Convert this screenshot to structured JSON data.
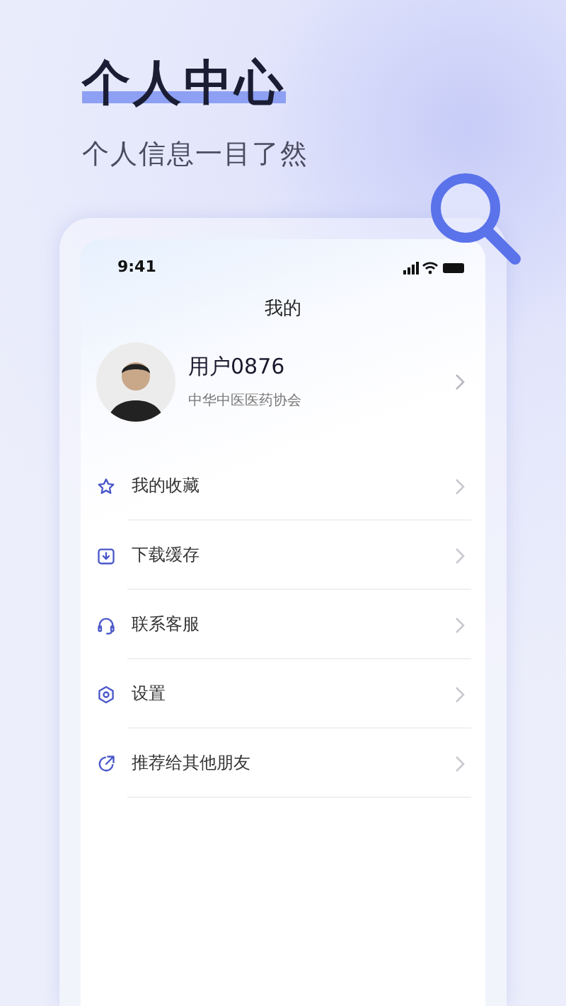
{
  "headline": "个人中心",
  "subtitle": "个人信息一目了然",
  "phone": {
    "status_time": "9:41",
    "title": "我的",
    "profile": {
      "name": "用户0876",
      "organization": "中华中医医药协会"
    },
    "menu": [
      {
        "kind": "star",
        "label": "我的收藏"
      },
      {
        "kind": "download",
        "label": "下载缓存"
      },
      {
        "kind": "headset",
        "label": "联系客服"
      },
      {
        "kind": "settings",
        "label": "设置"
      },
      {
        "kind": "share",
        "label": "推荐给其他朋友"
      }
    ]
  }
}
